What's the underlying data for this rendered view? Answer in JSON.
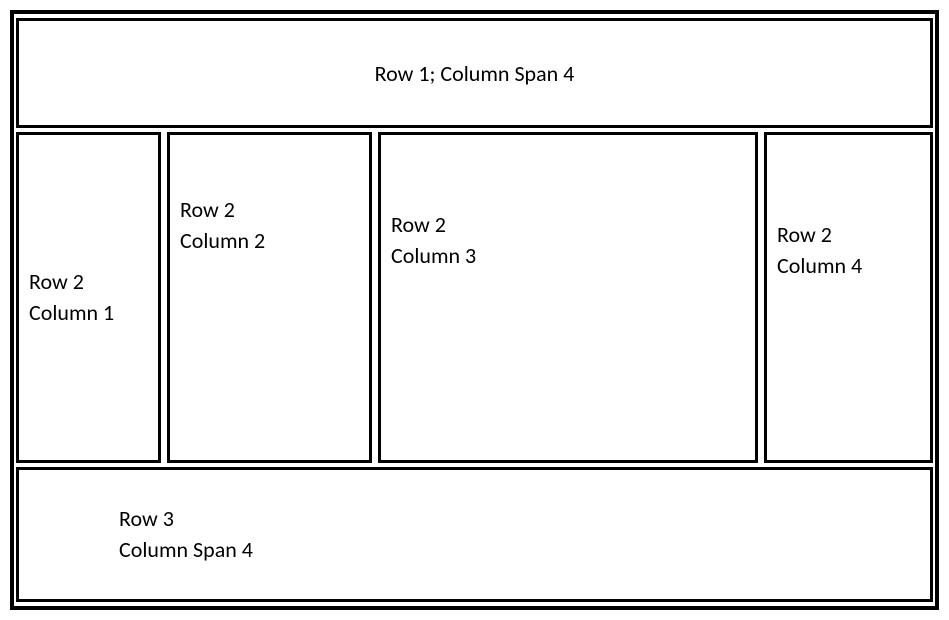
{
  "table": {
    "row1": {
      "label": "Row 1; Column Span 4"
    },
    "row2": {
      "col1": {
        "line1": "Row 2",
        "line2": "Column 1"
      },
      "col2": {
        "line1": "Row 2",
        "line2": "Column 2"
      },
      "col3": {
        "line1": "Row 2",
        "line2": "Column 3"
      },
      "col4": {
        "line1": "Row 2",
        "line2": "Column 4"
      }
    },
    "row3": {
      "line1": "Row 3",
      "line2": "Column Span 4"
    }
  }
}
